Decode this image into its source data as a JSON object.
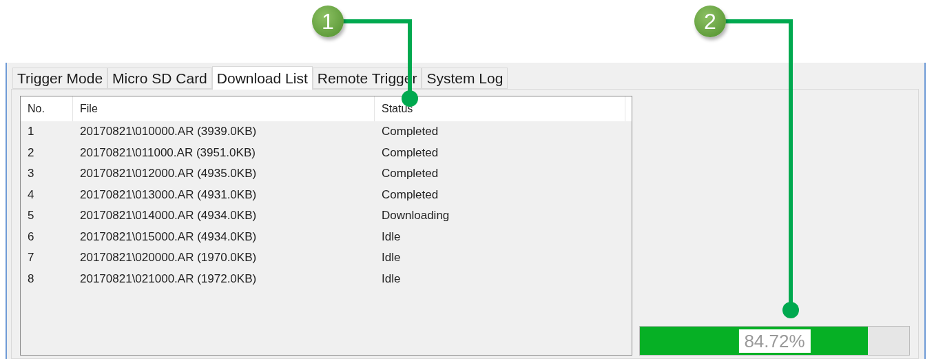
{
  "callouts": [
    {
      "label": "1"
    },
    {
      "label": "2"
    }
  ],
  "tabs": [
    {
      "label": "Trigger Mode",
      "selected": false
    },
    {
      "label": "Micro SD Card",
      "selected": false
    },
    {
      "label": "Download List",
      "selected": true
    },
    {
      "label": "Remote Trigger",
      "selected": false
    },
    {
      "label": "System Log",
      "selected": false
    }
  ],
  "table": {
    "columns": [
      "No.",
      "File",
      "Status"
    ],
    "rows": [
      {
        "no": "1",
        "file": "20170821\\010000.AR (3939.0KB)",
        "status": "Completed"
      },
      {
        "no": "2",
        "file": "20170821\\011000.AR (3951.0KB)",
        "status": "Completed"
      },
      {
        "no": "3",
        "file": "20170821\\012000.AR (4935.0KB)",
        "status": "Completed"
      },
      {
        "no": "4",
        "file": "20170821\\013000.AR (4931.0KB)",
        "status": "Completed"
      },
      {
        "no": "5",
        "file": "20170821\\014000.AR (4934.0KB)",
        "status": "Downloading"
      },
      {
        "no": "6",
        "file": "20170821\\015000.AR (4934.0KB)",
        "status": "Idle"
      },
      {
        "no": "7",
        "file": "20170821\\020000.AR (1970.0KB)",
        "status": "Idle"
      },
      {
        "no": "8",
        "file": "20170821\\021000.AR (1972.0KB)",
        "status": "Idle"
      }
    ]
  },
  "progress": {
    "level": 0.8472,
    "reading": "84.72%"
  }
}
